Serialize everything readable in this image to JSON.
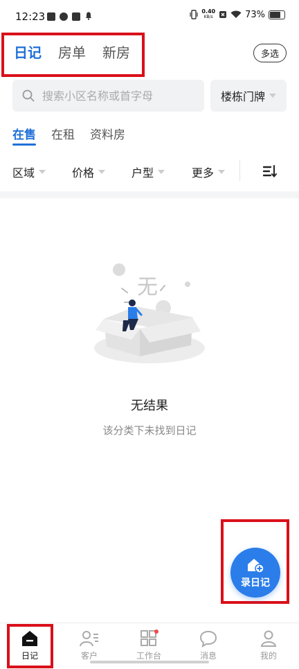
{
  "status_bar": {
    "time": "12:23",
    "net_speed_value": "0.40",
    "net_speed_unit": "KB/s",
    "battery": "73%"
  },
  "header": {
    "tabs": [
      {
        "label": "日记",
        "active": true
      },
      {
        "label": "房单",
        "active": false
      },
      {
        "label": "新房",
        "active": false
      }
    ],
    "multi_select_label": "多选"
  },
  "search": {
    "placeholder": "搜索小区名称或首字母",
    "building_select_label": "楼栋门牌"
  },
  "sub_tabs": [
    {
      "label": "在售",
      "active": true
    },
    {
      "label": "在租",
      "active": false
    },
    {
      "label": "资料房",
      "active": false
    }
  ],
  "filters": [
    {
      "label": "区域"
    },
    {
      "label": "价格"
    },
    {
      "label": "户型"
    },
    {
      "label": "更多"
    }
  ],
  "empty_state": {
    "illustration_text": "无",
    "title": "无结果",
    "subtitle": "该分类下未找到日记"
  },
  "fab": {
    "label": "录日记",
    "icon": "home-plus-icon"
  },
  "bottom_nav": [
    {
      "label": "日记",
      "icon": "home-icon",
      "active": true
    },
    {
      "label": "客户",
      "icon": "client-icon",
      "active": false
    },
    {
      "label": "工作台",
      "icon": "grid-icon",
      "active": false,
      "badge_dot": true
    },
    {
      "label": "消息",
      "icon": "message-icon",
      "active": false
    },
    {
      "label": "我的",
      "icon": "user-icon",
      "active": false
    }
  ],
  "colors": {
    "accent": "#1e6fd9",
    "fab": "#2b7de9",
    "highlight_box": "#d9101a"
  }
}
